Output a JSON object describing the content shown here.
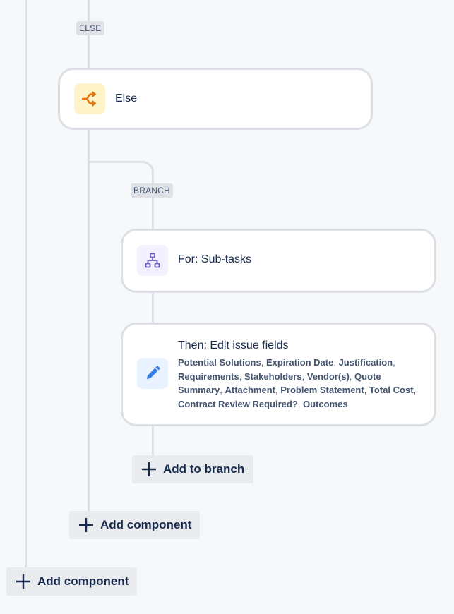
{
  "else_lozenge": "ELSE",
  "branch_lozenge": "BRANCH",
  "else_card": {
    "title": "Else",
    "icon": "branch-condition-icon",
    "icon_color": "#e2740c",
    "tile_color": "#fff3c9"
  },
  "for_card": {
    "title": "For: Sub-tasks",
    "icon": "hierarchy-icon",
    "icon_color": "#6e5dc6",
    "tile_color": "#f3f0ff"
  },
  "then_card": {
    "title": "Then: Edit issue fields",
    "icon": "pencil-icon",
    "icon_color": "#357de8",
    "tile_color": "#e9f2ff",
    "fields": [
      "Potential Solutions",
      "Expiration Date",
      "Justification",
      "Requirements",
      "Stakeholders",
      "Vendor(s)",
      "Quote Summary",
      "Attachment",
      "Problem Statement",
      "Total Cost",
      "Contract Review Required?",
      "Outcomes"
    ]
  },
  "buttons": {
    "add_to_branch": "Add to branch",
    "add_component_inner": "Add component",
    "add_component_outer": "Add component"
  }
}
